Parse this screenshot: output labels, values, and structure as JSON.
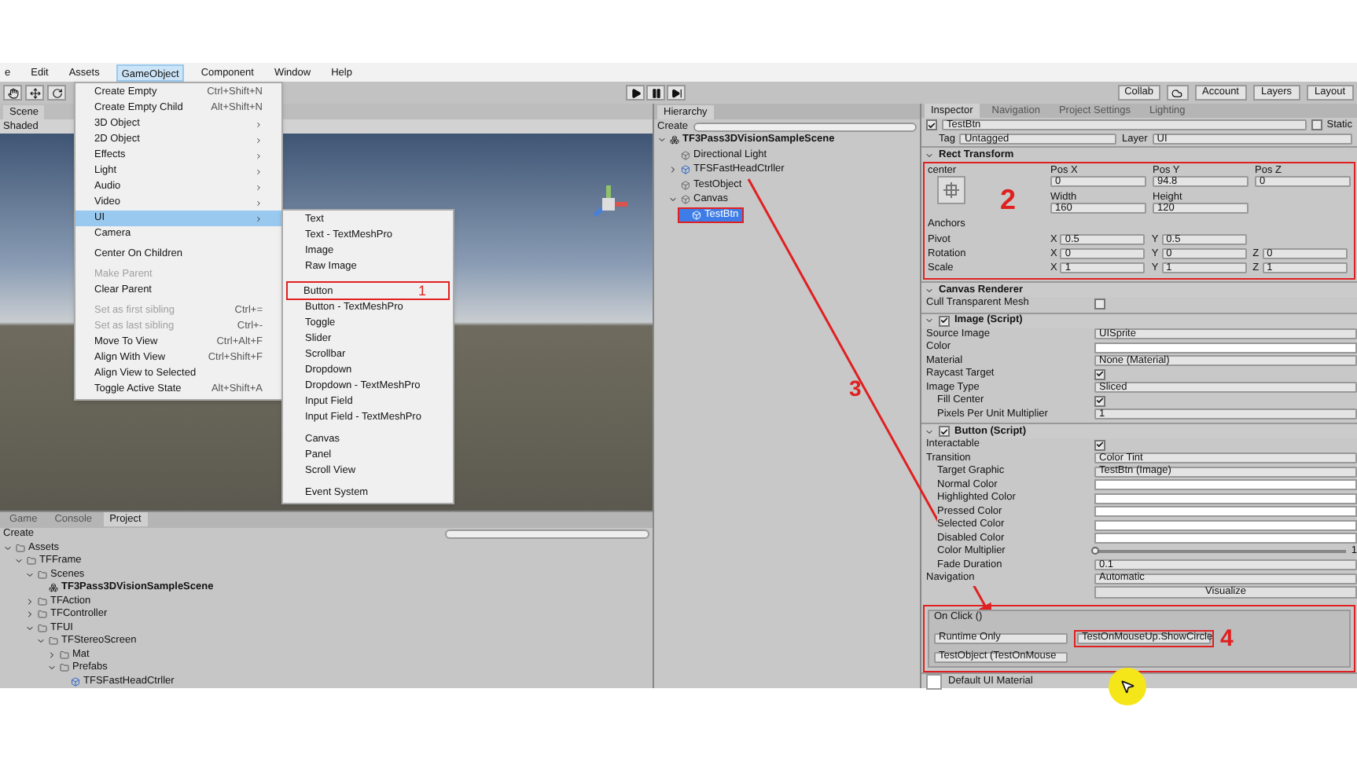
{
  "menu_bar": [
    {
      "label": "e",
      "selected": false
    },
    {
      "label": "Edit",
      "selected": false
    },
    {
      "label": "Assets",
      "selected": false
    },
    {
      "label": "GameObject",
      "selected": true
    },
    {
      "label": "Component",
      "selected": false
    },
    {
      "label": "Window",
      "selected": false
    },
    {
      "label": "Help",
      "selected": false
    }
  ],
  "toolbar": {
    "buttons": [
      "Collab",
      "Account",
      "Layers",
      "Layout"
    ]
  },
  "scene": {
    "tab": "Scene",
    "shading": "Shaded"
  },
  "gameobject_menu": {
    "items": [
      {
        "kind": "item",
        "label": "Create Empty",
        "shortcut": "Ctrl+Shift+N",
        "submenu": false,
        "disabled": false,
        "selected": false
      },
      {
        "kind": "item",
        "label": "Create Empty Child",
        "shortcut": "Alt+Shift+N",
        "submenu": false,
        "disabled": false,
        "selected": false
      },
      {
        "kind": "item",
        "label": "3D Object",
        "submenu": true,
        "disabled": false,
        "selected": false
      },
      {
        "kind": "item",
        "label": "2D Object",
        "submenu": true,
        "disabled": false,
        "selected": false
      },
      {
        "kind": "item",
        "label": "Effects",
        "submenu": true,
        "disabled": false,
        "selected": false
      },
      {
        "kind": "item",
        "label": "Light",
        "submenu": true,
        "disabled": false,
        "selected": false
      },
      {
        "kind": "item",
        "label": "Audio",
        "submenu": true,
        "disabled": false,
        "selected": false
      },
      {
        "kind": "item",
        "label": "Video",
        "submenu": true,
        "disabled": false,
        "selected": false
      },
      {
        "kind": "item",
        "label": "UI",
        "submenu": true,
        "disabled": false,
        "selected": true
      },
      {
        "kind": "item",
        "label": "Camera",
        "submenu": false,
        "disabled": false,
        "selected": false
      },
      {
        "kind": "separator"
      },
      {
        "kind": "item",
        "label": "Center On Children",
        "submenu": false,
        "disabled": false,
        "selected": false
      },
      {
        "kind": "separator"
      },
      {
        "kind": "item",
        "label": "Make Parent",
        "submenu": false,
        "disabled": true,
        "selected": false
      },
      {
        "kind": "item",
        "label": "Clear Parent",
        "submenu": false,
        "disabled": false,
        "selected": false
      },
      {
        "kind": "separator"
      },
      {
        "kind": "item",
        "label": "Set as first sibling",
        "shortcut": "Ctrl+=",
        "submenu": false,
        "disabled": true,
        "selected": false
      },
      {
        "kind": "item",
        "label": "Set as last sibling",
        "shortcut": "Ctrl+-",
        "submenu": false,
        "disabled": true,
        "selected": false
      },
      {
        "kind": "item",
        "label": "Move To View",
        "shortcut": "Ctrl+Alt+F",
        "submenu": false,
        "disabled": false,
        "selected": false
      },
      {
        "kind": "item",
        "label": "Align With View",
        "shortcut": "Ctrl+Shift+F",
        "submenu": false,
        "disabled": false,
        "selected": false
      },
      {
        "kind": "item",
        "label": "Align View to Selected",
        "submenu": false,
        "disabled": false,
        "selected": false
      },
      {
        "kind": "item",
        "label": "Toggle Active State",
        "shortcut": "Alt+Shift+A",
        "submenu": false,
        "disabled": false,
        "selected": false
      }
    ]
  },
  "ui_submenu": {
    "items": [
      {
        "kind": "item",
        "label": "Text"
      },
      {
        "kind": "item",
        "label": "Text - TextMeshPro"
      },
      {
        "kind": "item",
        "label": "Image"
      },
      {
        "kind": "item",
        "label": "Raw Image"
      },
      {
        "kind": "separator"
      },
      {
        "kind": "item",
        "label": "Button",
        "annotation": "1"
      },
      {
        "kind": "item",
        "label": "Button - TextMeshPro"
      },
      {
        "kind": "item",
        "label": "Toggle"
      },
      {
        "kind": "item",
        "label": "Slider"
      },
      {
        "kind": "item",
        "label": "Scrollbar"
      },
      {
        "kind": "item",
        "label": "Dropdown"
      },
      {
        "kind": "item",
        "label": "Dropdown - TextMeshPro"
      },
      {
        "kind": "item",
        "label": "Input Field"
      },
      {
        "kind": "item",
        "label": "Input Field - TextMeshPro"
      },
      {
        "kind": "separator"
      },
      {
        "kind": "item",
        "label": "Canvas"
      },
      {
        "kind": "item",
        "label": "Panel"
      },
      {
        "kind": "item",
        "label": "Scroll View"
      },
      {
        "kind": "separator"
      },
      {
        "kind": "item",
        "label": "Event System"
      }
    ]
  },
  "hierarchy": {
    "title": "Hierarchy",
    "create": "Create",
    "tree": [
      {
        "label": "TF3Pass3DVisionSampleScene",
        "kind": "scene",
        "selected": false,
        "boxed": false,
        "expanded": true,
        "children": [
          {
            "label": "Directional Light",
            "kind": "object",
            "selected": false,
            "boxed": false
          },
          {
            "label": "TFSFastHeadCtrller",
            "kind": "prefab",
            "selected": false,
            "boxed": false,
            "expanded": false
          },
          {
            "label": "TestObject",
            "kind": "object",
            "selected": false,
            "boxed": false
          },
          {
            "label": "Canvas",
            "kind": "object",
            "selected": false,
            "boxed": false,
            "expanded": true,
            "children": [
              {
                "label": "TestBtn",
                "kind": "object",
                "selected": true,
                "boxed": true
              }
            ]
          }
        ]
      }
    ]
  },
  "inspector": {
    "tabs": [
      {
        "label": "Inspector",
        "selected": true
      },
      {
        "label": "Navigation",
        "selected": false
      },
      {
        "label": "Project Settings",
        "selected": false
      },
      {
        "label": "Lighting",
        "selected": false
      }
    ],
    "object": {
      "name": "TestBtn",
      "active": true,
      "static_label": "Static",
      "static": false,
      "tag_label": "Tag",
      "tag": "Untagged",
      "layer_label": "Layer",
      "layer": "UI"
    },
    "rect_transform": {
      "title": "Rect Transform",
      "annotation": "2",
      "anchor_preset": "center",
      "anchors_label": "Anchors",
      "position": [
        {
          "header": "Pos X",
          "value": "0"
        },
        {
          "header": "Pos Y",
          "value": "94.8"
        },
        {
          "header": "Pos Z",
          "value": "0"
        }
      ],
      "size": [
        {
          "header": "Width",
          "value": "160"
        },
        {
          "header": "Height",
          "value": "120"
        }
      ],
      "rows": [
        {
          "label": "Pivot",
          "fields": [
            {
              "axis": "X",
              "value": "0.5"
            },
            {
              "axis": "Y",
              "value": "0.5"
            }
          ]
        },
        {
          "label": "Rotation",
          "fields": [
            {
              "axis": "X",
              "value": "0"
            },
            {
              "axis": "Y",
              "value": "0"
            },
            {
              "axis": "Z",
              "value": "0"
            }
          ]
        },
        {
          "label": "Scale",
          "fields": [
            {
              "axis": "X",
              "value": "1"
            },
            {
              "axis": "Y",
              "value": "1"
            },
            {
              "axis": "Z",
              "value": "1"
            }
          ]
        }
      ]
    },
    "components": [
      {
        "title": "Canvas Renderer",
        "has_toggle": false,
        "rows": [
          {
            "kind": "check",
            "label": "Cull Transparent Mesh",
            "checked": false,
            "indent": false
          }
        ]
      },
      {
        "title": "Image (Script)",
        "has_toggle": true,
        "enabled": true,
        "rows": [
          {
            "kind": "object",
            "label": "Source Image",
            "value": "UISprite",
            "indent": false
          },
          {
            "kind": "color",
            "label": "Color",
            "indent": false
          },
          {
            "kind": "field",
            "label": "Material",
            "value": "None (Material)",
            "indent": false
          },
          {
            "kind": "check",
            "label": "Raycast Target",
            "checked": true,
            "indent": false
          },
          {
            "kind": "dropdown",
            "label": "Image Type",
            "value": "Sliced",
            "indent": false
          },
          {
            "kind": "check",
            "label": "Fill Center",
            "checked": true,
            "indent": true
          },
          {
            "kind": "field",
            "label": "Pixels Per Unit Multiplier",
            "value": "1",
            "indent": true
          }
        ]
      },
      {
        "title": "Button (Script)",
        "has_toggle": true,
        "enabled": true,
        "rows": [
          {
            "kind": "check",
            "label": "Interactable",
            "checked": true,
            "indent": false
          },
          {
            "kind": "dropdown",
            "label": "Transition",
            "value": "Color Tint",
            "indent": false
          },
          {
            "kind": "object",
            "label": "Target Graphic",
            "value": "TestBtn (Image)",
            "indent": true
          },
          {
            "kind": "color",
            "label": "Normal Color",
            "indent": true
          },
          {
            "kind": "color",
            "label": "Highlighted Color",
            "indent": true
          },
          {
            "kind": "color",
            "label": "Pressed Color",
            "indent": true
          },
          {
            "kind": "color",
            "label": "Selected Color",
            "indent": true
          },
          {
            "kind": "color",
            "label": "Disabled Color",
            "indent": true
          },
          {
            "kind": "slider",
            "label": "Color Multiplier",
            "level": 0,
            "reading": "1",
            "indent": true
          },
          {
            "kind": "field",
            "label": "Fade Duration",
            "value": "0.1",
            "indent": true
          },
          {
            "kind": "dropdown",
            "label": "Navigation",
            "value": "Automatic",
            "indent": false
          },
          {
            "kind": "button",
            "label": "Visualize"
          }
        ]
      }
    ],
    "on_click": {
      "title": "On Click ()",
      "boxed": true,
      "runtime": "Runtime Only",
      "function": "TestOnMouseUp.ShowCircle",
      "function_annotation": "4",
      "object": "TestObject (TestOnMouse"
    },
    "material": {
      "name": "Default UI Material"
    }
  },
  "project": {
    "tabs": [
      {
        "label": "Game",
        "selected": false
      },
      {
        "label": "Console",
        "selected": false
      },
      {
        "label": "Project",
        "selected": true
      }
    ],
    "create": "Create",
    "tree": [
      {
        "label": "Assets",
        "kind": "folder",
        "expanded": true,
        "children": [
          {
            "label": "TFFrame",
            "kind": "folder",
            "expanded": true,
            "children": [
              {
                "label": "Scenes",
                "kind": "folder",
                "expanded": true,
                "children": [
                  {
                    "label": "TF3Pass3DVisionSampleScene",
                    "kind": "scene"
                  }
                ]
              },
              {
                "label": "TFAction",
                "kind": "folder",
                "expanded": false
              },
              {
                "label": "TFController",
                "kind": "folder",
                "expanded": false
              },
              {
                "label": "TFUI",
                "kind": "folder",
                "expanded": true,
                "children": [
                  {
                    "label": "TFStereoScreen",
                    "kind": "folder",
                    "expanded": true,
                    "children": [
                      {
                        "label": "Mat",
                        "kind": "folder",
                        "expanded": false
                      },
                      {
                        "label": "Prefabs",
                        "kind": "folder",
                        "expanded": true,
                        "children": [
                          {
                            "label": "TFSFastHeadCtrller",
                            "kind": "prefab"
                          }
                        ]
                      }
                    ]
                  }
                ]
              }
            ]
          }
        ]
      }
    ]
  },
  "arrow": {
    "label": "3"
  }
}
